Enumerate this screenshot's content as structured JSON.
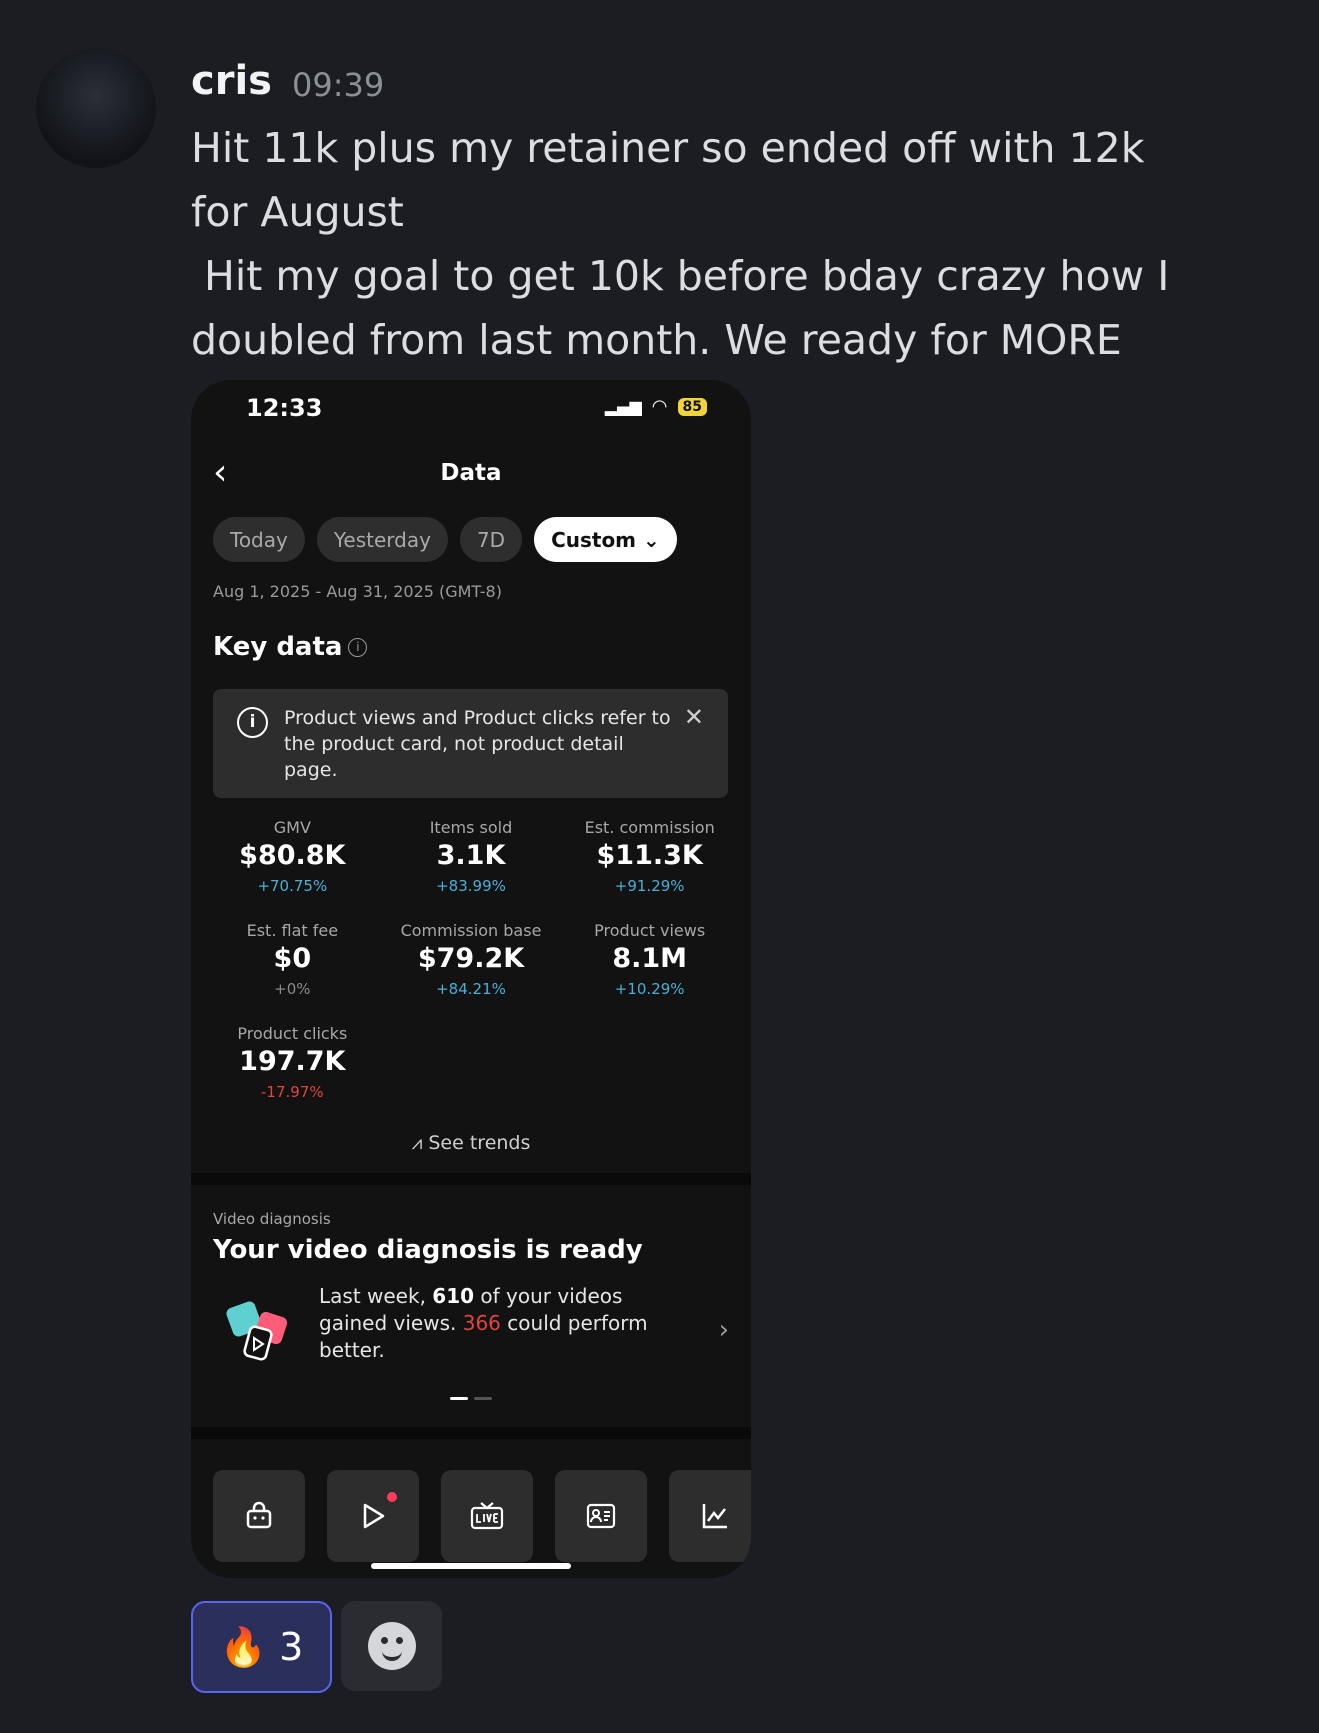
{
  "message": {
    "author": "cris",
    "time": "09:39",
    "text": "Hit 11k plus my retainer so ended off with 12k for August\n Hit my goal to get 10k before bday crazy how I doubled from last month. We ready for MORE"
  },
  "phone": {
    "status_time": "12:33",
    "battery": "85",
    "title": "Data",
    "tabs": [
      "Today",
      "Yesterday",
      "7D",
      "Custom ⌄"
    ],
    "date_range": "Aug 1, 2025 - Aug 31, 2025 (GMT-8)",
    "key_data_title": "Key data",
    "notice": "Product views and Product clicks refer to the product card, not product detail page.",
    "metrics": [
      {
        "label": "GMV",
        "value": "$80.8K",
        "delta": "+70.75%"
      },
      {
        "label": "Items sold",
        "value": "3.1K",
        "delta": "+83.99%"
      },
      {
        "label": "Est. commission",
        "value": "$11.3K",
        "delta": "+91.29%"
      },
      {
        "label": "Est. flat fee",
        "value": "$0",
        "delta": "+0%"
      },
      {
        "label": "Commission base",
        "value": "$79.2K",
        "delta": "+84.21%"
      },
      {
        "label": "Product views",
        "value": "8.1M",
        "delta": "+10.29%"
      },
      {
        "label": "Product clicks",
        "value": "197.7K",
        "delta": "-17.97%"
      }
    ],
    "see_trends": "See trends",
    "video_diagnosis": {
      "label": "Video diagnosis",
      "title": "Your video diagnosis is ready",
      "text_1": "Last week, ",
      "count_videos": "610",
      "text_2": " of your videos gained views. ",
      "count_better": "366",
      "text_3": " could perform better."
    }
  },
  "reaction": {
    "emoji": "🔥",
    "count": "3"
  },
  "colors": {
    "accent": "#5865f2",
    "positive": "#4ab0d9",
    "negative": "#e2453c"
  }
}
